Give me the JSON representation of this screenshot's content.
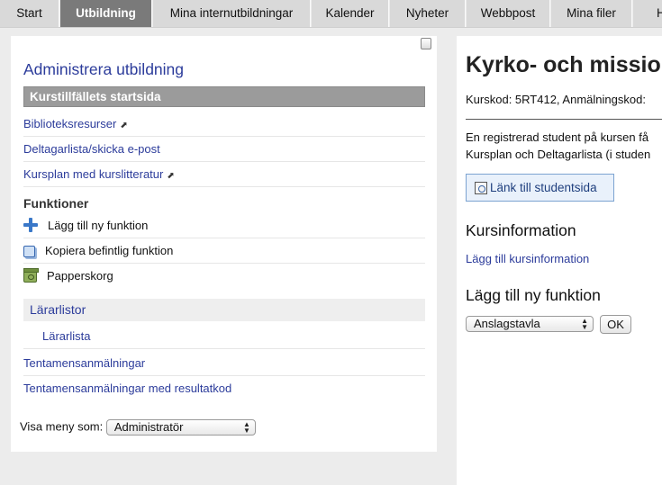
{
  "tabs": [
    {
      "label": "Start",
      "active": false
    },
    {
      "label": "Utbildning",
      "active": true
    },
    {
      "label": "Mina internutbildningar",
      "active": false
    },
    {
      "label": "Kalender",
      "active": false
    },
    {
      "label": "Nyheter",
      "active": false
    },
    {
      "label": "Webbpost",
      "active": false
    },
    {
      "label": "Mina filer",
      "active": false
    },
    {
      "label": "Hjä",
      "active": false
    }
  ],
  "left": {
    "title": "Administrera utbildning",
    "start_page": "Kurstillfällets startsida",
    "links": [
      {
        "label": "Biblioteksresurser",
        "external": true
      },
      {
        "label": "Deltagarlista/skicka e-post",
        "external": false
      },
      {
        "label": "Kursplan med kurslitteratur",
        "external": true
      }
    ],
    "external_glyph": "⬈",
    "functions_heading": "Funktioner",
    "functions": [
      {
        "label": "Lägg till ny funktion",
        "icon": "plus-icon"
      },
      {
        "label": "Kopiera befintlig funktion",
        "icon": "copy-icon"
      },
      {
        "label": "Papperskorg",
        "icon": "trash-icon"
      }
    ],
    "teacher_lists_heading": "Lärarlistor",
    "teacher_list": "Lärarlista",
    "exam_links": [
      "Tentamensanmälningar",
      "Tentamensanmälningar med resultatkod"
    ],
    "menu_as_label": "Visa meny som:",
    "menu_as_value": "Administratör"
  },
  "right": {
    "course_title": "Kyrko- och missio",
    "course_code": "Kurskod: 5RT412, Anmälningskod:",
    "info_line1": "En registrerad student på kursen få",
    "info_line2": "Kursplan och Deltagarlista (i studen",
    "student_link": "Länk till studentsida",
    "course_info_heading": "Kursinformation",
    "add_course_info": "Lägg till kursinformation",
    "add_function_heading": "Lägg till ny funktion",
    "function_select_value": "Anslagstavla",
    "ok_label": "OK"
  },
  "colors": {
    "link": "#2c3c9b",
    "active_tab": "#7a7a7a",
    "start_bar": "#9b9b9b"
  }
}
